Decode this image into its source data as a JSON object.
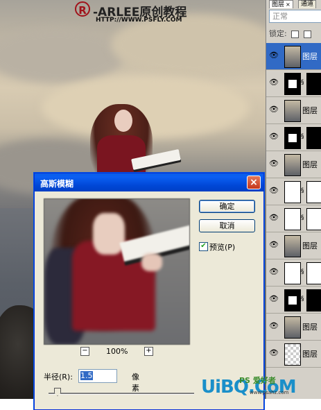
{
  "watermark_top": {
    "registered": "R",
    "title": "-ARLEE原创教程",
    "url": "HTTP://WWW.PSFLY.COM"
  },
  "layers_panel": {
    "tabs": [
      {
        "label": "图层",
        "close": "×"
      },
      {
        "label": "通道"
      }
    ],
    "blend_mode": "正常",
    "lock_label": "锁定:",
    "layers": [
      {
        "label": "图层",
        "selected": true
      },
      {
        "label": ""
      },
      {
        "label": "图层"
      },
      {
        "label": ""
      },
      {
        "label": "图层"
      },
      {
        "label": ""
      },
      {
        "label": ""
      },
      {
        "label": "图层"
      },
      {
        "label": ""
      },
      {
        "label": ""
      },
      {
        "label": "图层"
      },
      {
        "label": "图层"
      }
    ]
  },
  "dialog": {
    "title": "高斯模糊",
    "close": "×",
    "ok_label": "确定",
    "cancel_label": "取消",
    "preview_label": "预览(P)",
    "preview_checked": true,
    "zoom_minus": "−",
    "zoom_plus": "+",
    "zoom": "100%",
    "radius_label": "半径(R):",
    "radius_value": "1.5",
    "radius_unit": "像素"
  },
  "watermark_bottom": {
    "main": "UiBQ.CoM",
    "sub": "PS 爱好者",
    "url": "www.psahz.com"
  },
  "colors": {
    "titlebar": "#0046d5",
    "logo_red": "#a0131b",
    "watermark_blue": "#1a8fc9"
  }
}
